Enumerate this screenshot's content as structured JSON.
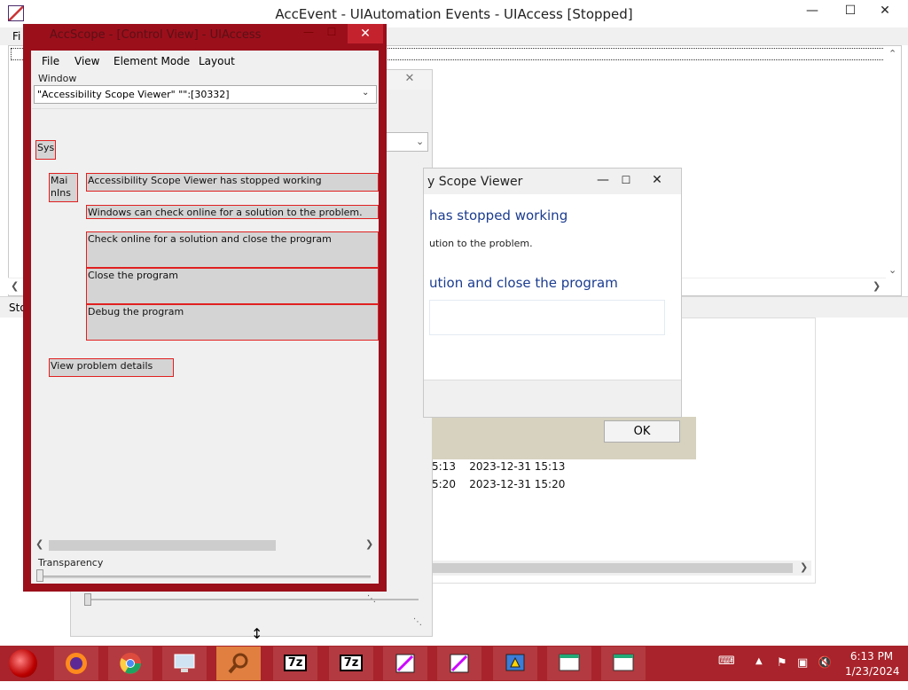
{
  "accevent": {
    "title": "AccEvent - UIAutomation Events - UIAccess [Stopped]",
    "menu_first": "Fi",
    "status_text": "Sto",
    "event_rows": [
      {
        "a": "5:13",
        "b": "2023-12-31 15:13"
      },
      {
        "a": "5:20",
        "b": "2023-12-31 15:20"
      }
    ]
  },
  "error_dialog": {
    "title": "y Scope Viewer",
    "headline": "has stopped working",
    "sub": "ution to the problem.",
    "option": "ution and close the program",
    "ok_label": "OK"
  },
  "accscope": {
    "title": "AccScope - [Control View] - UIAccess",
    "menu": {
      "file": "File",
      "view": "View",
      "element_mode": "Element Mode",
      "layout": "Layout"
    },
    "window_label": "Window",
    "window_value": "\"Accessibility Scope Viewer\" \"\":[30332]",
    "elements": {
      "sys": "Sys",
      "mai": "Mai nIns",
      "stopped": "Accessibility Scope Viewer has stopped working",
      "windows_can_check": "Windows can check online for a solution to the problem.",
      "check_online": "Check online for a solution and close the program",
      "close_program": "Close the program",
      "debug_program": "Debug the program",
      "view_details": "View problem details"
    },
    "transparency_label": "Transparency"
  },
  "taskbar": {
    "buttons": [
      "firefox-icon",
      "chrome-icon",
      "monitor-icon",
      "search-icon",
      "7z",
      "7z",
      "accevent-icon",
      "accevent-icon",
      "accscope-icon",
      "window-icon",
      "window-icon"
    ],
    "seven_zip_label": "7z",
    "time": "6:13 PM",
    "date": "1/23/2024"
  }
}
